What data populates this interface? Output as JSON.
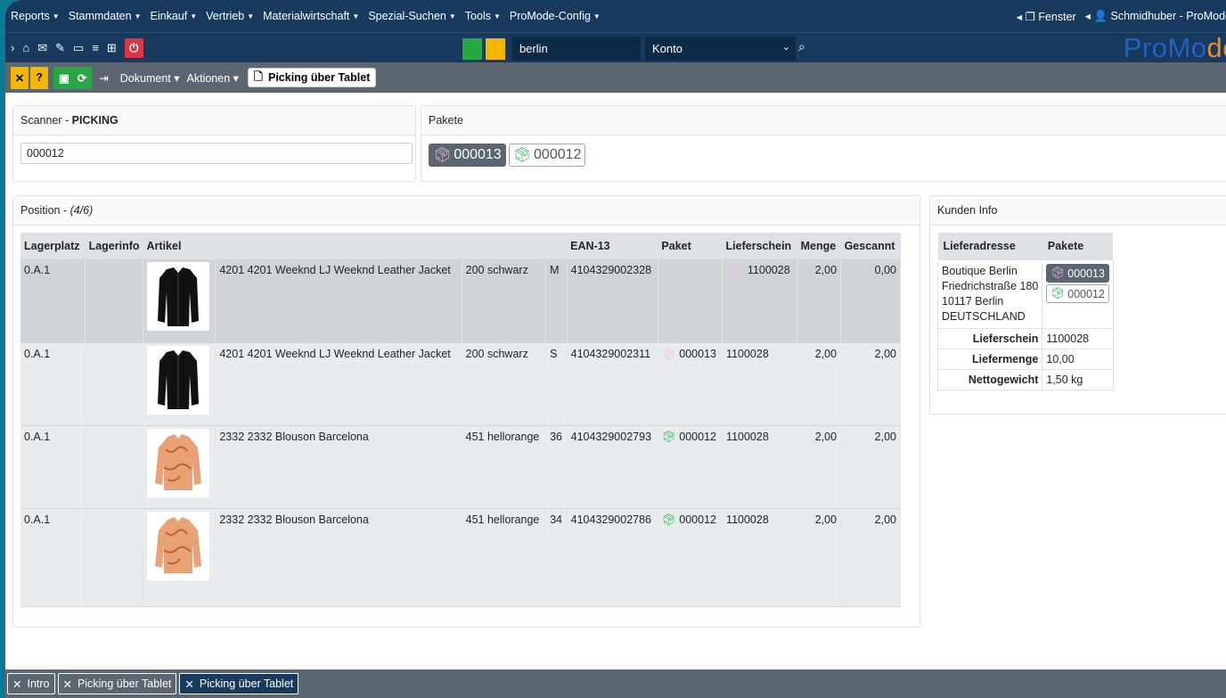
{
  "menu": {
    "items": [
      "Reports",
      "Stammdaten",
      "Einkauf",
      "Vertrieb",
      "Materialwirtschaft",
      "Spezial-Suchen",
      "Tools",
      "ProMode-Config"
    ],
    "fenster": "Fenster",
    "user": "Schmidhuber - ProMode"
  },
  "nav": {
    "city": "berlin",
    "konto": "Konto",
    "logo_a": "ProMo",
    "logo_b": "de",
    "colors": {
      "green": "#28a745",
      "yellow": "#f5b600"
    }
  },
  "toolbar": {
    "dokument": "Dokument",
    "aktionen": "Aktionen",
    "picking_btn": "Picking über Tablet"
  },
  "scanner": {
    "title_prefix": "Scanner - ",
    "title_bold": "PICKING",
    "value": "000012"
  },
  "pakete": {
    "title": "Pakete",
    "items": [
      {
        "id": "000013",
        "style": "dark",
        "icon_color": "#f7b6ea"
      },
      {
        "id": "000012",
        "style": "light",
        "icon_color": "#28a745"
      }
    ]
  },
  "position": {
    "title": "Position - ",
    "count": "(4/6)",
    "headers": [
      "Lagerplatz",
      "Lagerinfo",
      "Artikel",
      "",
      "",
      "",
      "EAN-13",
      "Paket",
      "Lieferschein",
      "Menge",
      "Gescannt"
    ],
    "rows": [
      {
        "lagerplatz": "0.A.1",
        "lagerinfo": "",
        "img": "black-leather-jacket",
        "artikel": "4201 4201 Weeknd LJ Weeknd Leather Jacket",
        "farbe": "200 schwarz",
        "groesse": "M",
        "ean": "4104329002328",
        "paket": "",
        "paket_color": "",
        "lieferschein": "1100028",
        "ls_icon_color": "#f7b6ea",
        "menge": "2,00",
        "gescannt": "0,00",
        "selected": true
      },
      {
        "lagerplatz": "0.A.1",
        "lagerinfo": "",
        "img": "black-leather-jacket",
        "artikel": "4201 4201 Weeknd LJ Weeknd Leather Jacket",
        "farbe": "200 schwarz",
        "groesse": "S",
        "ean": "4104329002311",
        "paket": "000013",
        "paket_color": "#f7b6ea",
        "lieferschein": "1100028",
        "ls_icon_color": "",
        "menge": "2,00",
        "gescannt": "2,00",
        "selected": false
      },
      {
        "lagerplatz": "0.A.1",
        "lagerinfo": "",
        "img": "orange-blouson",
        "artikel": "2332 2332 Blouson Barcelona",
        "farbe": "451 hellorange",
        "groesse": "36",
        "ean": "4104329002793",
        "paket": "000012",
        "paket_color": "#28a745",
        "lieferschein": "1100028",
        "ls_icon_color": "",
        "menge": "2,00",
        "gescannt": "2,00",
        "selected": false
      },
      {
        "lagerplatz": "0.A.1",
        "lagerinfo": "",
        "img": "orange-blouson",
        "artikel": "2332 2332 Blouson Barcelona",
        "farbe": "451 hellorange",
        "groesse": "34",
        "ean": "4104329002786",
        "paket": "000012",
        "paket_color": "#28a745",
        "lieferschein": "1100028",
        "ls_icon_color": "",
        "menge": "2,00",
        "gescannt": "2,00",
        "selected": false
      }
    ]
  },
  "kunden": {
    "title": "Kunden Info",
    "h_lieferadresse": "Lieferadresse",
    "h_pakete": "Pakete",
    "address": [
      "Boutique Berlin",
      "Friedrichstraße 180",
      "10117 Berlin",
      "DEUTSCHLAND"
    ],
    "pakete": [
      {
        "id": "000013",
        "style": "dark"
      },
      {
        "id": "000012",
        "style": "light"
      }
    ],
    "lieferschein_label": "Lieferschein",
    "lieferschein": "1100028",
    "liefermenge_label": "Liefermenge",
    "liefermenge": "10,00",
    "nettogewicht_label": "Nettogewicht",
    "nettogewicht": "1,50 kg"
  },
  "bottom_tabs": [
    {
      "label": "Intro",
      "active": false
    },
    {
      "label": "Picking über Tablet",
      "active": false
    },
    {
      "label": "Picking über Tablet",
      "active": true
    }
  ]
}
